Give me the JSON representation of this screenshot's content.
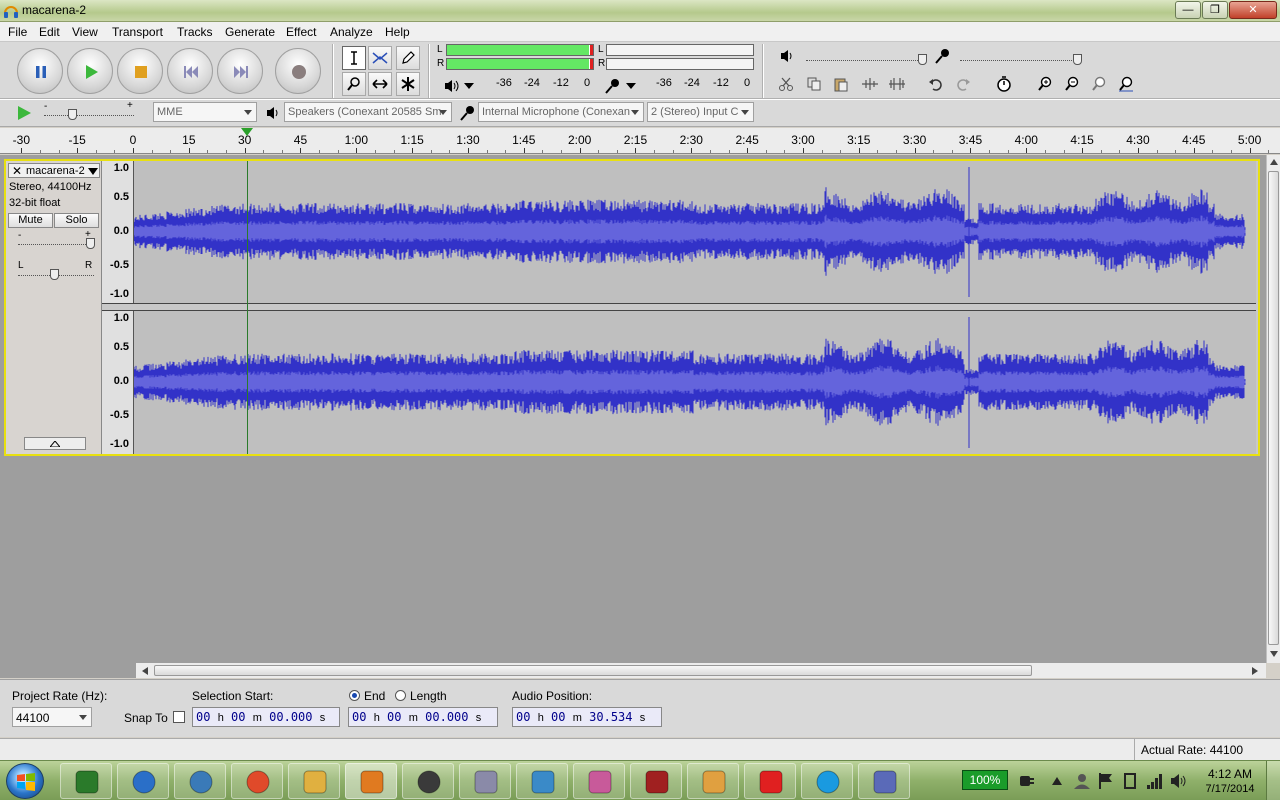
{
  "window": {
    "title": "macarena-2",
    "minimize": "—",
    "maximize": "❐",
    "close": "✕"
  },
  "menu": [
    "File",
    "Edit",
    "View",
    "Transport",
    "Tracks",
    "Generate",
    "Effect",
    "Analyze",
    "Help"
  ],
  "meters": {
    "playback": {
      "left_label": "L",
      "right_label": "R",
      "left_level": 0.97,
      "right_level": 0.97
    },
    "record": {
      "left_label": "L",
      "right_label": "R"
    },
    "playback_scale": [
      "-36",
      "-24",
      "-12",
      "0"
    ],
    "record_scale": [
      "-36",
      "-24",
      "-12",
      "0"
    ]
  },
  "devices": {
    "host": "MME",
    "output": "Speakers (Conexant 20585 Sm",
    "input": "Internal Microphone (Conexan",
    "channels": "2 (Stereo) Input C"
  },
  "ruler": {
    "labels": [
      "-30",
      "-15",
      "0",
      "15",
      "30",
      "45",
      "1:00",
      "1:15",
      "1:30",
      "1:45",
      "2:00",
      "2:15",
      "2:30",
      "2:45",
      "3:00",
      "3:15",
      "3:30",
      "3:45",
      "4:00",
      "4:15",
      "4:30",
      "4:45",
      "5:00"
    ],
    "playhead_seconds": 30.534
  },
  "track": {
    "name": "macarena-2",
    "close_icon": "✕",
    "info_line1": "Stereo, 44100Hz",
    "info_line2": "32-bit float",
    "mute_label": "Mute",
    "solo_label": "Solo",
    "gain_minus": "-",
    "gain_plus": "+",
    "pan_left": "L",
    "pan_right": "R",
    "scale": [
      "1.0",
      "0.5",
      "0.0",
      "-0.5",
      "-1.0"
    ],
    "waveform_color": "#3232c8",
    "rms_color": "#6464dc"
  },
  "selection": {
    "project_rate_label": "Project Rate (Hz):",
    "project_rate_value": "44100",
    "snap_to_label": "Snap To",
    "selection_start_label": "Selection Start:",
    "end_label": "End",
    "length_label": "Length",
    "audio_position_label": "Audio Position:",
    "start_time": {
      "h": "00",
      "m": "00",
      "s": "00.000"
    },
    "end_time": {
      "h": "00",
      "m": "00",
      "s": "00.000"
    },
    "audio_position": {
      "h": "00",
      "m": "00",
      "s": "30.534"
    },
    "unit_h": "h",
    "unit_m": "m",
    "unit_s": "s"
  },
  "status": {
    "actual_rate": "Actual Rate: 44100"
  },
  "taskbar": {
    "battery": "100%",
    "time": "4:12 AM",
    "date": "7/17/2014",
    "apps": [
      "terminal-icon",
      "globe-icon",
      "network-globe-icon",
      "chrome-icon",
      "folder-icon",
      "audacity-icon",
      "webcam-icon",
      "calculator-icon",
      "notepad-icon",
      "paint-icon",
      "video-icon",
      "user-icon",
      "download-icon",
      "skype-icon",
      "network-tools-icon"
    ]
  }
}
